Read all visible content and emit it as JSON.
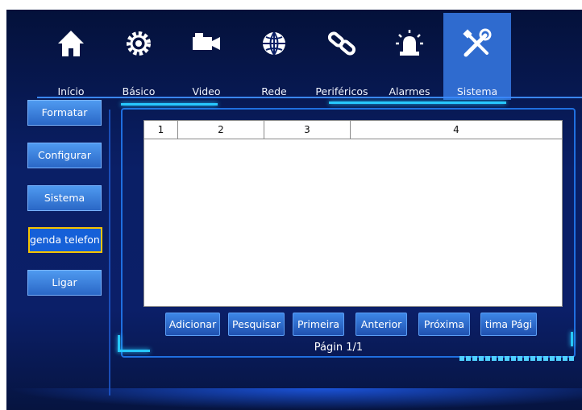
{
  "nav": {
    "tabs": [
      {
        "label": "Início",
        "icon": "home-icon",
        "selected": false
      },
      {
        "label": "Básico",
        "icon": "gear-icon",
        "selected": false
      },
      {
        "label": "Video",
        "icon": "video-camera-icon",
        "selected": false
      },
      {
        "label": "Rede",
        "icon": "globe-icon",
        "selected": false
      },
      {
        "label": "Periféricos",
        "icon": "chain-link-icon",
        "selected": false
      },
      {
        "label": "Alarmes",
        "icon": "alarm-siren-icon",
        "selected": false
      },
      {
        "label": "Sistema",
        "icon": "tools-icon",
        "selected": true
      }
    ]
  },
  "sidebar": {
    "items": [
      {
        "label": "Formatar",
        "selected": false
      },
      {
        "label": "Configurar",
        "selected": false
      },
      {
        "label": "Sistema",
        "selected": false
      },
      {
        "label": "genda telefonia",
        "selected": true
      },
      {
        "label": "Ligar",
        "selected": false
      }
    ]
  },
  "table": {
    "columns": [
      "1",
      "2",
      "3",
      "4"
    ],
    "rows": []
  },
  "actions": {
    "add": "Adicionar",
    "search": "Pesquisar",
    "first": "Primeira",
    "previous": "Anterior",
    "next": "Próxima",
    "last": "tima Pági"
  },
  "pagination": {
    "text": "Págin 1/1"
  },
  "colors": {
    "background": "#0a1f66",
    "accent": "#2a8cff",
    "selected_tab": "#2f6bcf",
    "selected_border": "#f5c400",
    "glow": "#27c8ff"
  }
}
